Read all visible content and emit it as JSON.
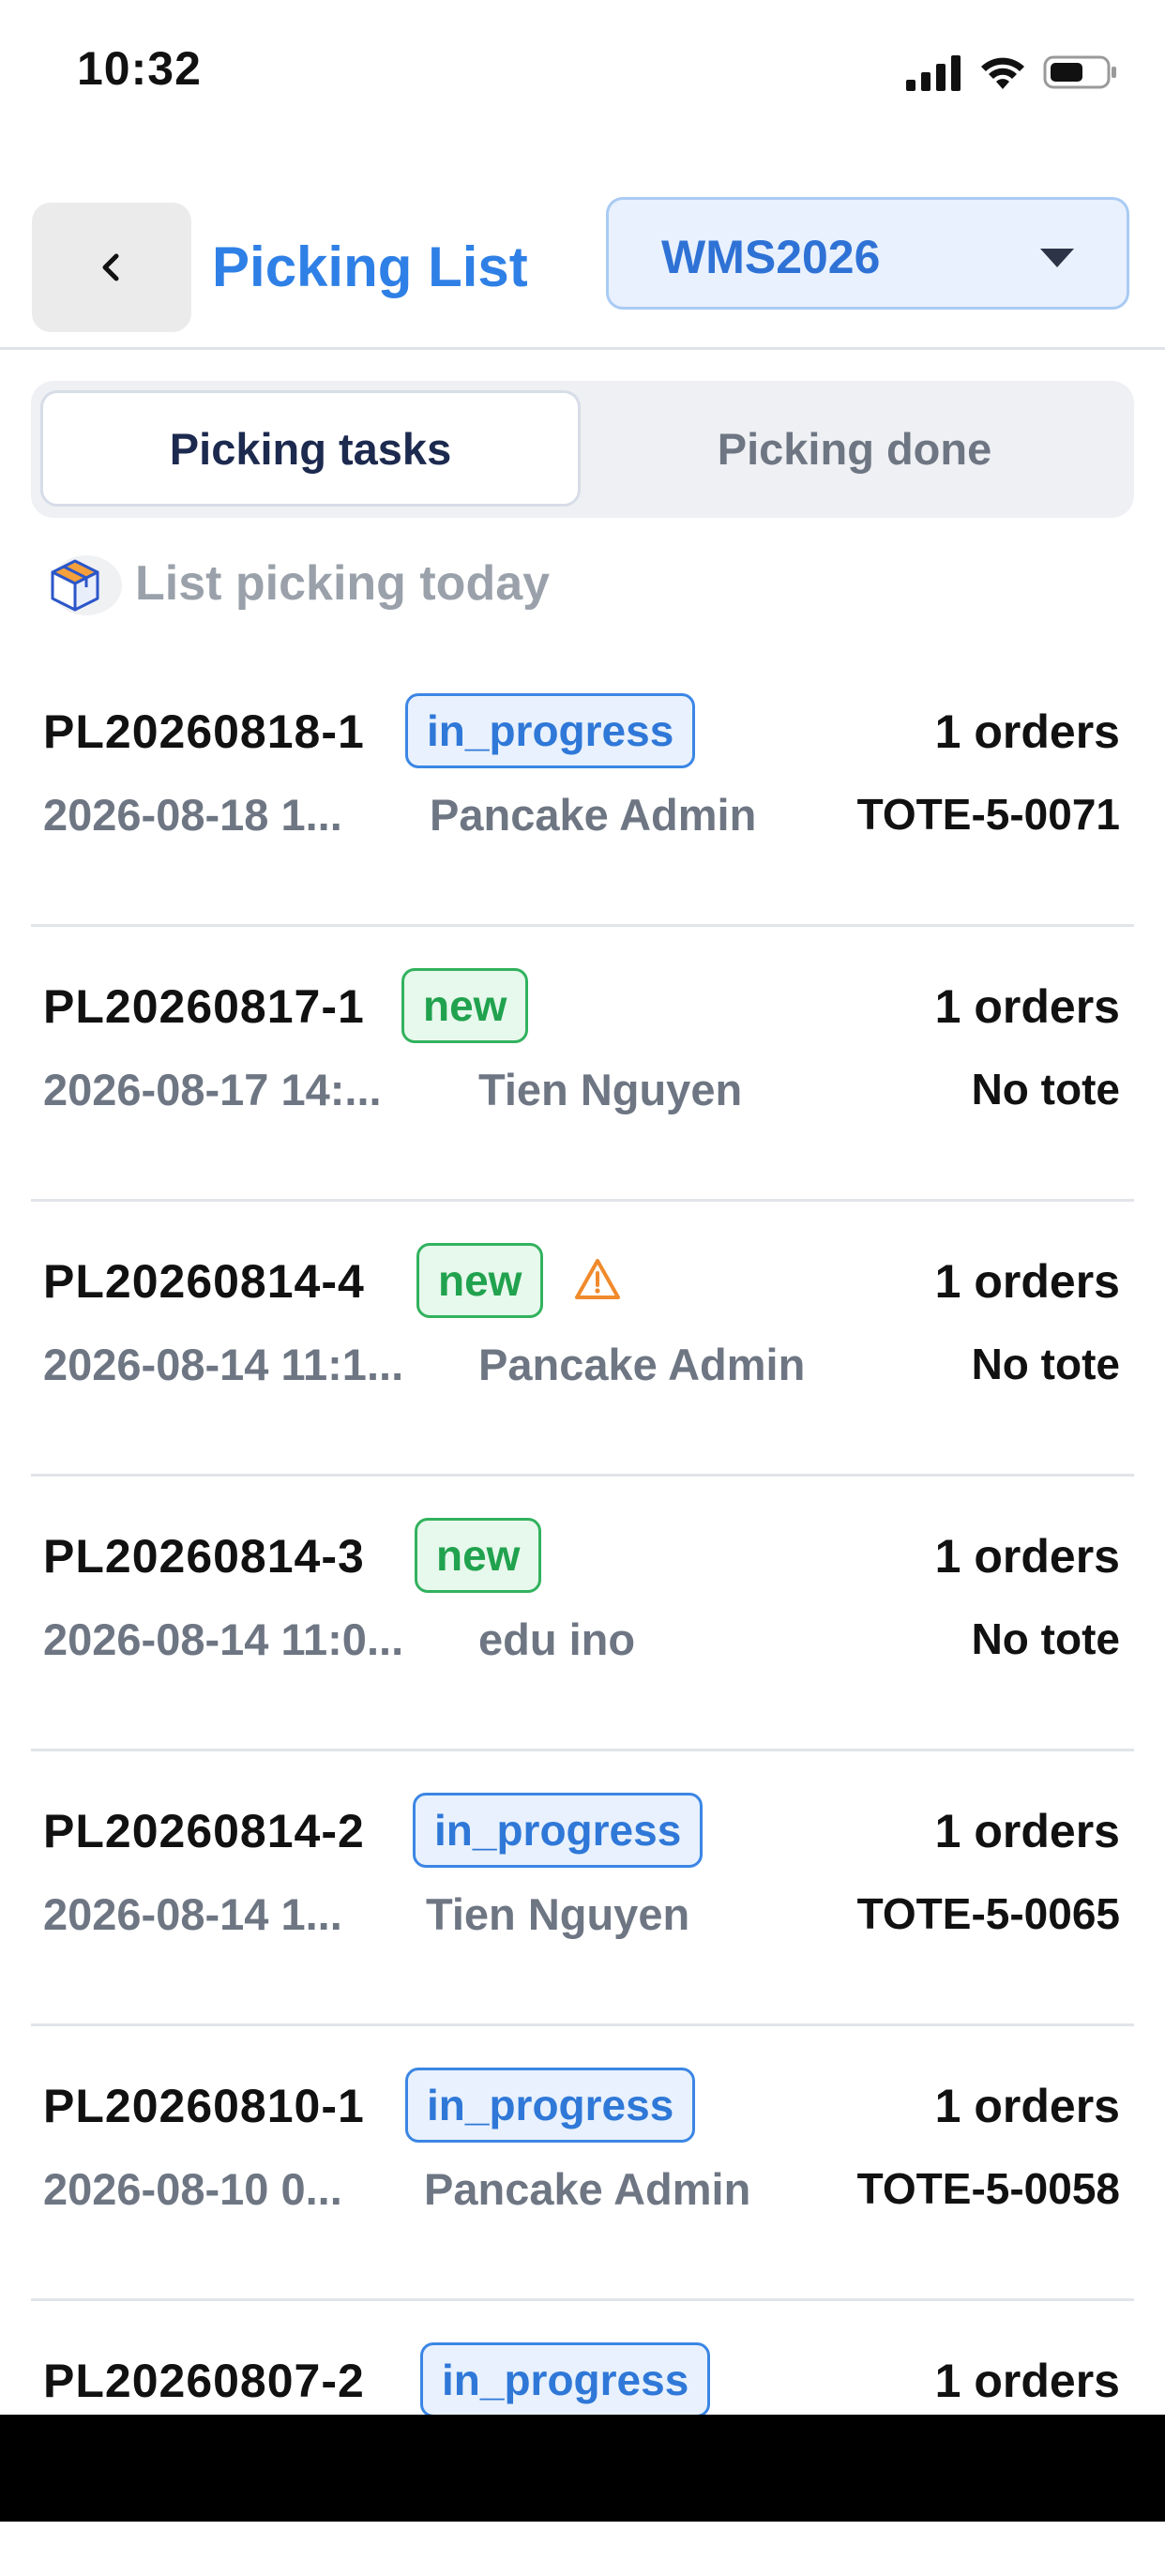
{
  "status_bar": {
    "time": "10:32"
  },
  "header": {
    "title": "Picking List",
    "warehouse": "WMS2026"
  },
  "tabs": [
    {
      "label": "Picking tasks",
      "active": true
    },
    {
      "label": "Picking done",
      "active": false
    }
  ],
  "section": {
    "title": "List picking today"
  },
  "items": [
    {
      "code": "PL20260818-1",
      "status": "in_progress",
      "warning": false,
      "orders": "1 orders",
      "date": "2026-08-18 1...",
      "user": "Pancake Admin",
      "tote": "TOTE-5-0071"
    },
    {
      "code": "PL20260817-1",
      "status": "new",
      "warning": false,
      "orders": "1 orders",
      "date": "2026-08-17 14:...",
      "user": "Tien Nguyen",
      "tote": "No tote"
    },
    {
      "code": "PL20260814-4",
      "status": "new",
      "warning": true,
      "orders": "1 orders",
      "date": "2026-08-14 11:1...",
      "user": "Pancake Admin",
      "tote": "No tote"
    },
    {
      "code": "PL20260814-3",
      "status": "new",
      "warning": false,
      "orders": "1 orders",
      "date": "2026-08-14 11:0...",
      "user": "edu ino",
      "tote": "No tote"
    },
    {
      "code": "PL20260814-2",
      "status": "in_progress",
      "warning": false,
      "orders": "1 orders",
      "date": "2026-08-14 1...",
      "user": "Tien Nguyen",
      "tote": "TOTE-5-0065"
    },
    {
      "code": "PL20260810-1",
      "status": "in_progress",
      "warning": false,
      "orders": "1 orders",
      "date": "2026-08-10 0...",
      "user": "Pancake Admin",
      "tote": "TOTE-5-0058"
    },
    {
      "code": "PL20260807-2",
      "status": "in_progress",
      "warning": false,
      "orders": "1 orders",
      "date": "",
      "user": "",
      "tote": ""
    }
  ],
  "colors": {
    "accent": "#2f80e6",
    "status_in_progress": "#2f78d8",
    "status_new": "#21a24e",
    "warning": "#f08a2c"
  }
}
